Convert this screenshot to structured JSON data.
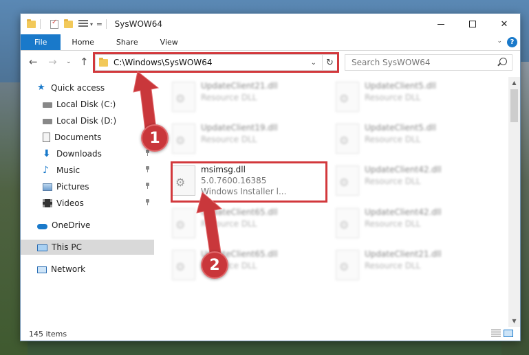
{
  "window": {
    "title": "SysWOW64",
    "controls": {
      "minimize": "–",
      "maximize": "□",
      "close": "✕"
    }
  },
  "ribbon": {
    "tabs": [
      "File",
      "Home",
      "Share",
      "View"
    ],
    "help": "?"
  },
  "address": {
    "path": "C:\\Windows\\SysWOW64"
  },
  "search": {
    "placeholder": "Search SysWOW64"
  },
  "sidebar": {
    "items": [
      {
        "label": "Quick access",
        "icon": "star-icon"
      },
      {
        "label": "Local Disk (C:)",
        "icon": "drive-icon"
      },
      {
        "label": "Local Disk (D:)",
        "icon": "drive-icon"
      },
      {
        "label": "Documents",
        "icon": "documents-icon"
      },
      {
        "label": "Downloads",
        "icon": "download-icon"
      },
      {
        "label": "Music",
        "icon": "music-icon"
      },
      {
        "label": "Pictures",
        "icon": "pictures-icon"
      },
      {
        "label": "Videos",
        "icon": "videos-icon"
      },
      {
        "label": "OneDrive",
        "icon": "cloud-icon"
      },
      {
        "label": "This PC",
        "icon": "computer-icon"
      },
      {
        "label": "Network",
        "icon": "network-icon"
      }
    ]
  },
  "files": [
    {
      "name": "UpdateClient21.dll",
      "desc": "Resource DLL"
    },
    {
      "name": "UpdateClient5.dll",
      "desc": "Resource DLL"
    },
    {
      "name": "UpdateClient19.dll",
      "desc": "Resource DLL"
    },
    {
      "name": "UpdateClient5.dll",
      "desc": "Resource DLL"
    },
    {
      "name": "msimsg.dll",
      "version": "5.0.7600.16385",
      "desc": "Windows Installer l..."
    },
    {
      "name": "UpdateClient42.dll",
      "desc": "Resource DLL"
    },
    {
      "name": "UpdateClient65.dll",
      "desc": "Resource DLL"
    },
    {
      "name": "UpdateClient42.dll",
      "desc": "Resource DLL"
    },
    {
      "name": "UpdateClient65.dll",
      "desc": "Resource DLL"
    },
    {
      "name": "UpdateClient21.dll",
      "desc": "Resource DLL"
    }
  ],
  "status": {
    "item_count": "145 items"
  },
  "annotations": {
    "step1": "1",
    "step2": "2",
    "highlight_color": "#d2383c"
  },
  "colors": {
    "accent": "#1979ca",
    "selected": "#d9d9d9"
  }
}
